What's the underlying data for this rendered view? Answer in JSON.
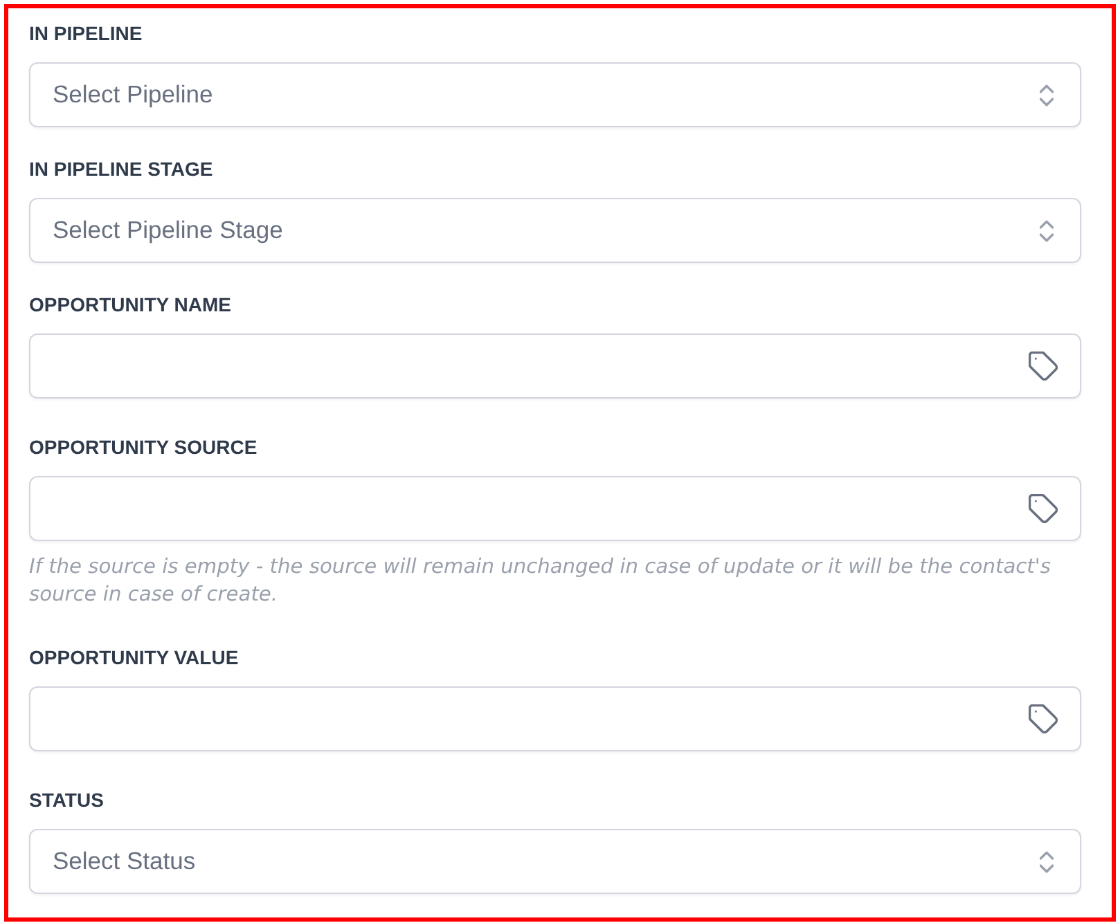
{
  "fields": [
    {
      "kind": "select",
      "label": "IN PIPELINE",
      "placeholder": "Select Pipeline"
    },
    {
      "kind": "select",
      "label": "IN PIPELINE STAGE",
      "placeholder": "Select Pipeline Stage"
    },
    {
      "kind": "tag_input",
      "label": "OPPORTUNITY NAME"
    },
    {
      "kind": "tag_input",
      "label": "OPPORTUNITY SOURCE",
      "help": "If the source is empty - the source will remain unchanged in case of update or it will be the contact's source in case of create."
    },
    {
      "kind": "tag_input",
      "label": "OPPORTUNITY VALUE"
    },
    {
      "kind": "select",
      "label": "STATUS",
      "placeholder": "Select Status"
    }
  ]
}
